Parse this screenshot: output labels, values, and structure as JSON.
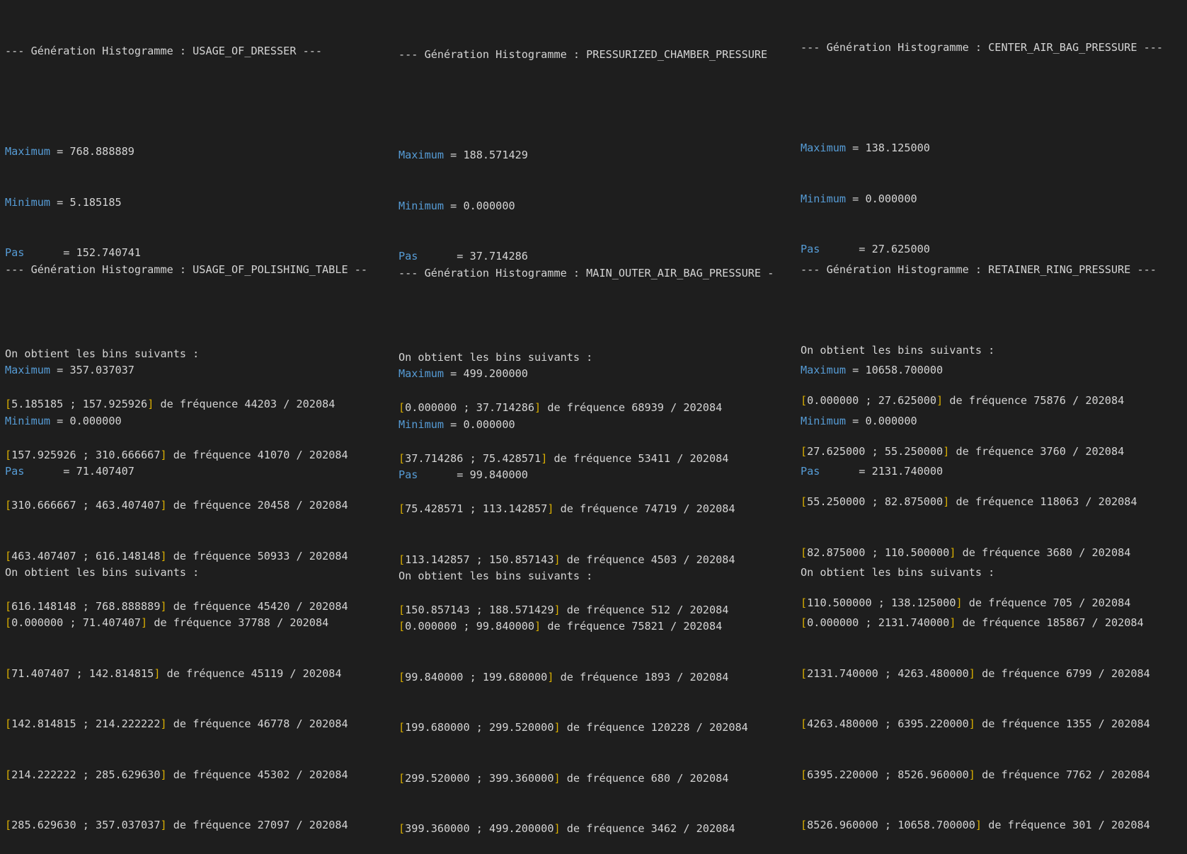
{
  "labels": {
    "maximum": "Maximum",
    "minimum": "Minimum",
    "pas": "Pas     ",
    "eq": " = ",
    "bins_intro": "On obtient les bins suivants :",
    "de_freq": " de fréquence ",
    "sep": " ; ",
    "of": " / ",
    "open": "[",
    "close": "]"
  },
  "panels": [
    {
      "header": "--- Génération Histogramme : USAGE_OF_DRESSER ---",
      "maximum": "768.888889",
      "minimum": "5.185185",
      "pas": "152.740741",
      "bins": [
        {
          "lo": "5.185185",
          "hi": "157.925926",
          "freq": "44203",
          "total": "202084"
        },
        {
          "lo": "157.925926",
          "hi": "310.666667",
          "freq": "41070",
          "total": "202084"
        },
        {
          "lo": "310.666667",
          "hi": "463.407407",
          "freq": "20458",
          "total": "202084"
        },
        {
          "lo": "463.407407",
          "hi": "616.148148",
          "freq": "50933",
          "total": "202084"
        },
        {
          "lo": "616.148148",
          "hi": "768.888889",
          "freq": "45420",
          "total": "202084"
        }
      ]
    },
    {
      "header": "--- Génération Histogramme : PRESSURIZED_CHAMBER_PRESSURE",
      "maximum": "188.571429",
      "minimum": "0.000000",
      "pas": "37.714286",
      "bins": [
        {
          "lo": "0.000000",
          "hi": "37.714286",
          "freq": "68939",
          "total": "202084"
        },
        {
          "lo": "37.714286",
          "hi": "75.428571",
          "freq": "53411",
          "total": "202084"
        },
        {
          "lo": "75.428571",
          "hi": "113.142857",
          "freq": "74719",
          "total": "202084"
        },
        {
          "lo": "113.142857",
          "hi": "150.857143",
          "freq": "4503",
          "total": "202084"
        },
        {
          "lo": "150.857143",
          "hi": "188.571429",
          "freq": "512",
          "total": "202084"
        }
      ]
    },
    {
      "header": "--- Génération Histogramme : CENTER_AIR_BAG_PRESSURE ---",
      "maximum": "138.125000",
      "minimum": "0.000000",
      "pas": "27.625000",
      "bins": [
        {
          "lo": "0.000000",
          "hi": "27.625000",
          "freq": "75876",
          "total": "202084"
        },
        {
          "lo": "27.625000",
          "hi": "55.250000",
          "freq": "3760",
          "total": "202084"
        },
        {
          "lo": "55.250000",
          "hi": "82.875000",
          "freq": "118063",
          "total": "202084"
        },
        {
          "lo": "82.875000",
          "hi": "110.500000",
          "freq": "3680",
          "total": "202084"
        },
        {
          "lo": "110.500000",
          "hi": "138.125000",
          "freq": "705",
          "total": "202084"
        }
      ]
    },
    {
      "header": "--- Génération Histogramme : USAGE_OF_POLISHING_TABLE --",
      "maximum": "357.037037",
      "minimum": "0.000000",
      "pas": "71.407407",
      "bins": [
        {
          "lo": "0.000000",
          "hi": "71.407407",
          "freq": "37788",
          "total": "202084"
        },
        {
          "lo": "71.407407",
          "hi": "142.814815",
          "freq": "45119",
          "total": "202084"
        },
        {
          "lo": "142.814815",
          "hi": "214.222222",
          "freq": "46778",
          "total": "202084"
        },
        {
          "lo": "214.222222",
          "hi": "285.629630",
          "freq": "45302",
          "total": "202084"
        },
        {
          "lo": "285.629630",
          "hi": "357.037037",
          "freq": "27097",
          "total": "202084"
        }
      ]
    },
    {
      "header": "--- Génération Histogramme : MAIN_OUTER_AIR_BAG_PRESSURE -",
      "maximum": "499.200000",
      "minimum": "0.000000",
      "pas": "99.840000",
      "bins": [
        {
          "lo": "0.000000",
          "hi": "99.840000",
          "freq": "75821",
          "total": "202084"
        },
        {
          "lo": "99.840000",
          "hi": "199.680000",
          "freq": "1893",
          "total": "202084"
        },
        {
          "lo": "199.680000",
          "hi": "299.520000",
          "freq": "120228",
          "total": "202084"
        },
        {
          "lo": "299.520000",
          "hi": "399.360000",
          "freq": "680",
          "total": "202084"
        },
        {
          "lo": "399.360000",
          "hi": "499.200000",
          "freq": "3462",
          "total": "202084"
        }
      ]
    },
    {
      "header": "--- Génération Histogramme : RETAINER_RING_PRESSURE ---",
      "maximum": "10658.700000",
      "minimum": "0.000000",
      "pas": "2131.740000",
      "bins": [
        {
          "lo": "0.000000",
          "hi": "2131.740000",
          "freq": "185867",
          "total": "202084"
        },
        {
          "lo": "2131.740000",
          "hi": "4263.480000",
          "freq": "6799",
          "total": "202084"
        },
        {
          "lo": "4263.480000",
          "hi": "6395.220000",
          "freq": "1355",
          "total": "202084"
        },
        {
          "lo": "6395.220000",
          "hi": "8526.960000",
          "freq": "7762",
          "total": "202084"
        },
        {
          "lo": "8526.960000",
          "hi": "10658.700000",
          "freq": "301",
          "total": "202084"
        }
      ]
    }
  ]
}
